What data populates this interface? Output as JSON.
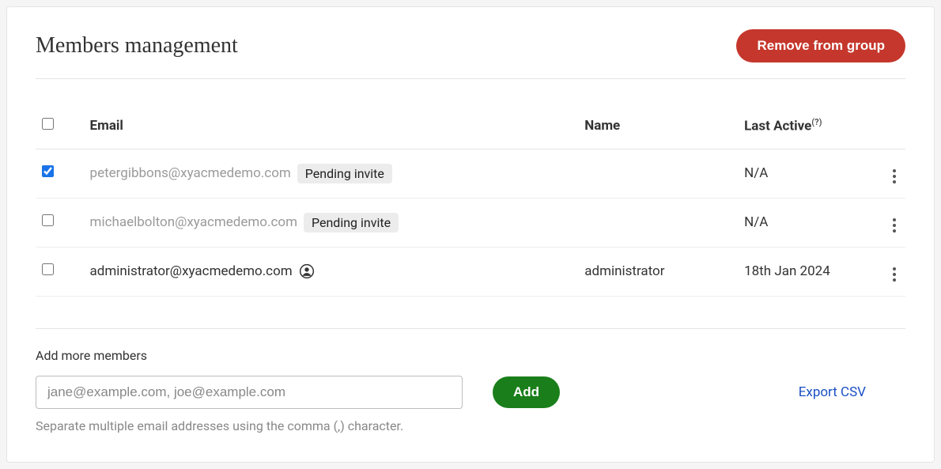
{
  "header": {
    "title": "Members management",
    "remove_label": "Remove from group"
  },
  "table": {
    "columns": {
      "email": "Email",
      "name": "Name",
      "last_active": "Last Active",
      "last_active_hint": "(?)"
    },
    "rows": [
      {
        "checked": true,
        "email": "petergibbons@xyacmedemo.com",
        "pending": true,
        "badge": "Pending invite",
        "owner": false,
        "name": "",
        "last_active": "N/A",
        "na": true
      },
      {
        "checked": false,
        "email": "michaelbolton@xyacmedemo.com",
        "pending": true,
        "badge": "Pending invite",
        "owner": false,
        "name": "",
        "last_active": "N/A",
        "na": true
      },
      {
        "checked": false,
        "email": "administrator@xyacmedemo.com",
        "pending": false,
        "badge": "",
        "owner": true,
        "name": "administrator",
        "last_active": "18th Jan 2024",
        "na": false
      }
    ]
  },
  "add": {
    "label": "Add more members",
    "placeholder": "jane@example.com, joe@example.com",
    "button": "Add",
    "hint": "Separate multiple email addresses using the comma (,) character."
  },
  "export_label": "Export CSV"
}
